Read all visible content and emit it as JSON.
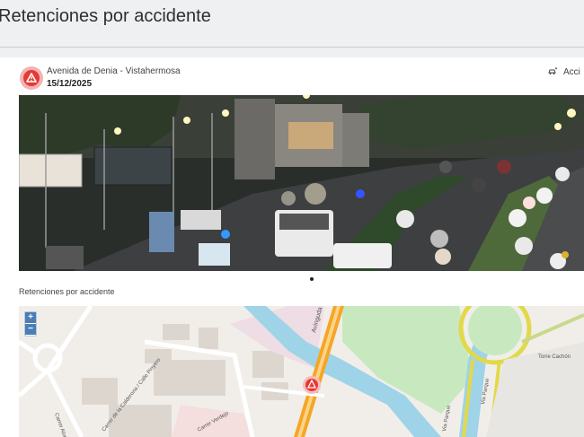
{
  "header": {
    "title": "Retenciones por accidente"
  },
  "incident": {
    "location": "Avenida de Denia - Vistahermosa",
    "date": "15/12/2025",
    "type_label": "Acci"
  },
  "camera": {
    "image_label": "traffic-camera-image"
  },
  "map_section": {
    "label": "Retenciones por accidente"
  },
  "map": {
    "zoom_in": "+",
    "zoom_out": "−",
    "street_labels": [
      "Avinguda de Dénia / Avenida de Dénia",
      "Carrer de la Calderona / Calle Pinyero",
      "Via Parque",
      "Via Parque",
      "Torre Cachón",
      "Carrer Alondra",
      "Carrer Verdejo"
    ]
  },
  "colors": {
    "accent": "#e53935",
    "map_water": "#9fd3e8",
    "map_park": "#c8e9c0",
    "map_road": "#f5a623"
  }
}
